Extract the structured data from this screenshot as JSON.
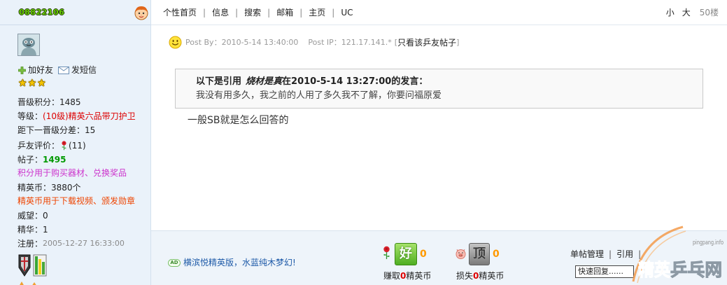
{
  "colors": {
    "username": "#66cc00",
    "level": "#dd0000",
    "posts": "#009900",
    "points_note": "#cc33cc",
    "coins_note": "#ee4400",
    "ad_link": "#1e5aa8",
    "rating_count": "#ff9900",
    "earn_count": "#dd0000",
    "sidebar_bg": "#eaf2fa",
    "footer_bg": "#eef4fa"
  },
  "icons": {
    "user_face": "cartoon-face-icon",
    "add_friend": "plus-icon",
    "send_message": "envelope-icon",
    "rating": "star-icon",
    "evaluation": "rose-icon",
    "post_mood": "smiley-icon",
    "good_rating": "rose-icon",
    "bad_rating": "pig-icon",
    "medals": [
      "shield-medal-icon",
      "bars-medal-icon"
    ]
  },
  "user": {
    "username": "08822106",
    "add_friend_label": "加好友",
    "send_message_label": "发短信",
    "star_count": 3,
    "stats": {
      "points_label": "晋级积分：",
      "points_value": "1485",
      "level_label": "等级：",
      "level_value": "(10级)精英六品带刀护卫",
      "gap_label": "距下一晋级分差：",
      "gap_value": "15",
      "rating_label": "乒友评价：",
      "rating_value": "(11)",
      "posts_label": "帖子：",
      "posts_value": "1495",
      "points_note": "积分用于购买器材、兑换奖品",
      "coins_label": "精英币：",
      "coins_value": "3880个",
      "coins_note": "精英币用于下载视频、颁发勋章",
      "prestige_label": "威望：",
      "prestige_value": "0",
      "essence_label": "精华：",
      "essence_value": "1",
      "register_label": "注册：",
      "register_value": "2005-12-27 16:33:00"
    }
  },
  "topbar": {
    "nav": [
      "个性首页",
      "信息",
      "搜索",
      "邮箱",
      "主页",
      "UC"
    ],
    "separator": "|",
    "font_small": "小",
    "font_large": "大",
    "floor": "50楼"
  },
  "post": {
    "meta": {
      "by_label": "Post By：",
      "time": "2010-5-14 13:40:00",
      "ip_label": "Post IP：",
      "ip": "121.17.141.*",
      "bracket_open": "[",
      "only_author_link": "只看该乒友帖子",
      "bracket_close": "]"
    },
    "quote": {
      "prefix": "以下是引用",
      "author": "烧材是真",
      "suffix": "在2010-5-14 13:27:00的发言：",
      "text": "我没有用多久，我之前的人用了多久我不了解，你要问福原爱"
    },
    "body": "一般SB就是怎么回答的"
  },
  "footer": {
    "ad_badge": "AD",
    "ad_text": "横滨悦精英版，水蓝纯木梦幻!",
    "good": {
      "button": "好",
      "count": "0",
      "caption_prefix": "赚取",
      "caption_value": "0",
      "caption_suffix": "精英币"
    },
    "bad": {
      "button": "顶",
      "count": "0",
      "caption_prefix": "损失",
      "caption_value": "0",
      "caption_suffix": "精英币"
    },
    "actions": [
      "单帖管理",
      "引用"
    ],
    "separator": "|",
    "quick_reply": "快速回复......"
  },
  "watermark": {
    "site": "pingpang.info",
    "name_part1": "精英",
    "name_part2": "乒乓网"
  }
}
